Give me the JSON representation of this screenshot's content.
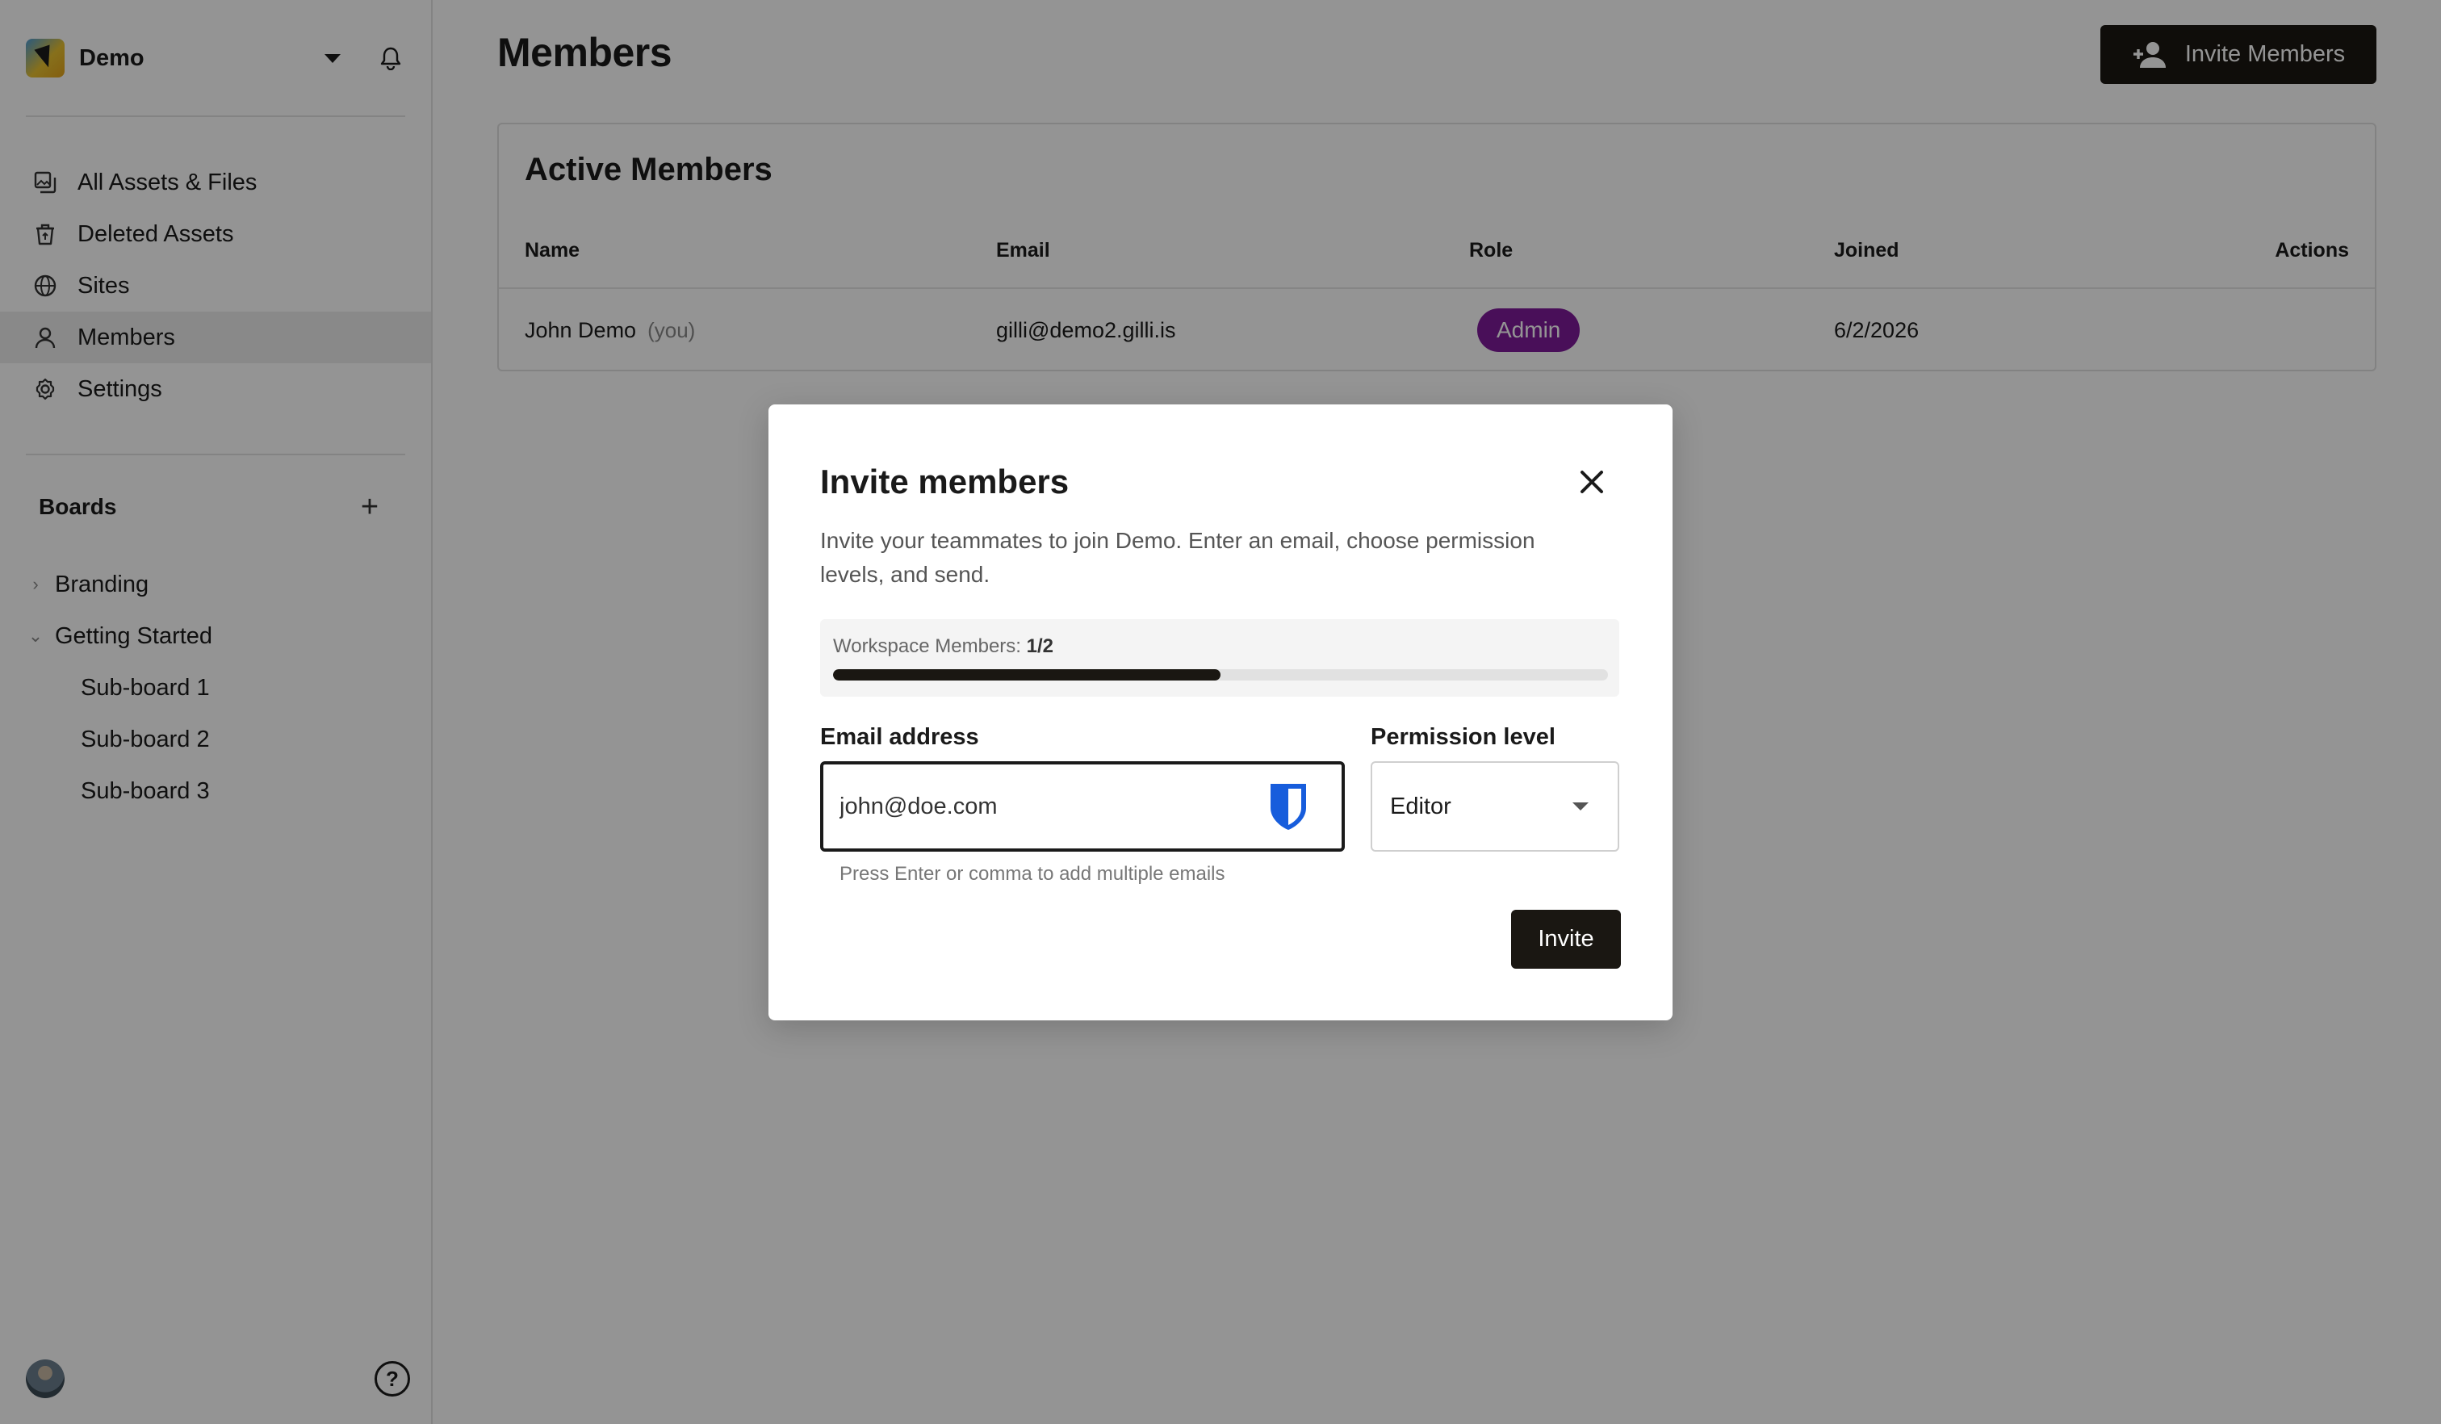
{
  "workspace": {
    "name": "Demo"
  },
  "nav": {
    "items": [
      {
        "label": "All Assets & Files",
        "icon": "assets-icon"
      },
      {
        "label": "Deleted Assets",
        "icon": "trash-icon"
      },
      {
        "label": "Sites",
        "icon": "globe-icon"
      },
      {
        "label": "Members",
        "icon": "person-icon",
        "active": true
      },
      {
        "label": "Settings",
        "icon": "gear-icon"
      }
    ]
  },
  "boards": {
    "title": "Boards",
    "items": [
      {
        "label": "Branding",
        "expanded": false
      },
      {
        "label": "Getting Started",
        "expanded": true
      },
      {
        "label": "Sub-board 1"
      },
      {
        "label": "Sub-board 2"
      },
      {
        "label": "Sub-board 3"
      }
    ]
  },
  "page": {
    "title": "Members",
    "invite_button": "Invite Members"
  },
  "members": {
    "title": "Active Members",
    "columns": [
      "Name",
      "Email",
      "Role",
      "Joined",
      "Actions"
    ],
    "rows": [
      {
        "name": "John Demo",
        "you": "(you)",
        "email": "gilli@demo2.gilli.is",
        "role": "Admin",
        "joined": "6/2/2026"
      }
    ]
  },
  "modal": {
    "title": "Invite members",
    "description": "Invite your teammates to join Demo. Enter an email, choose permission levels, and send.",
    "quota_label": "Workspace Members:",
    "quota_value": "1/2",
    "quota_fraction": 0.5,
    "email_label": "Email address",
    "email_value": "john@doe.com",
    "permission_label": "Permission level",
    "permission_value": "Editor",
    "helper": "Press Enter or comma to add multiple emails",
    "submit": "Invite"
  },
  "colors": {
    "accent_dark": "#1a1712",
    "admin_badge": "#7e1b9a",
    "bitwarden_blue": "#175ddc"
  }
}
